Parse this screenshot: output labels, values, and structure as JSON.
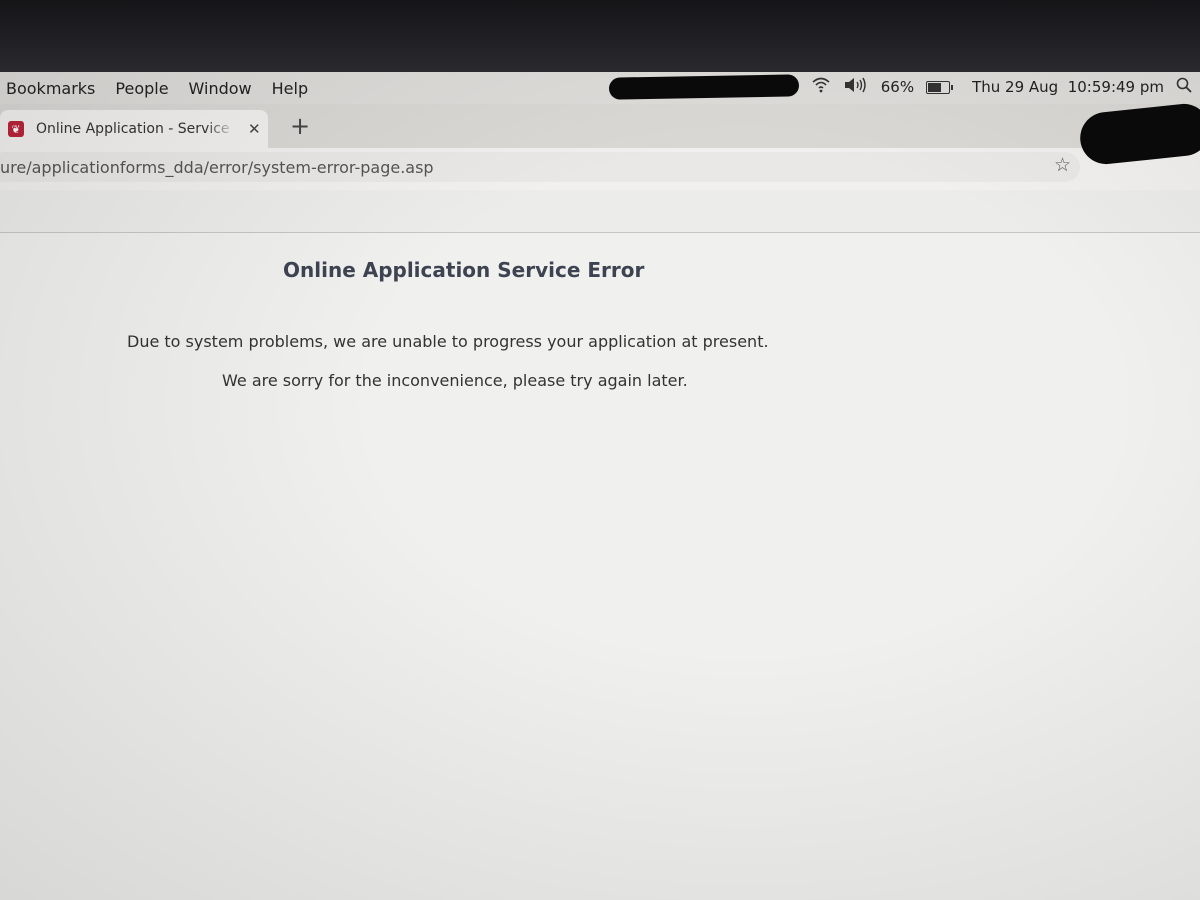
{
  "menubar": {
    "items": [
      "Bookmarks",
      "People",
      "Window",
      "Help"
    ],
    "battery_percent": "66%",
    "datetime": "Thu 29 Aug  10:59:49 pm"
  },
  "tab": {
    "title": "Online Application - Service Error",
    "close_glyph": "✕",
    "new_tab_glyph": "+"
  },
  "address_bar": {
    "url": "ure/applicationforms_dda/error/system-error-page.asp",
    "star_glyph": "☆"
  },
  "page": {
    "title": "Online Application Service Error",
    "message_line1": "Due to system problems, we are unable to progress your application at present.",
    "message_line2": "We are sorry for the inconvenience, please try again later."
  },
  "icons": {
    "wifi": "wifi-icon",
    "volume": "volume-icon",
    "battery": "battery-icon",
    "search": "search-icon",
    "favicon": "site-favicon-icon",
    "bookmark": "star-icon"
  },
  "colors": {
    "page_title": "#3d4351",
    "favicon": "#b8253a"
  }
}
